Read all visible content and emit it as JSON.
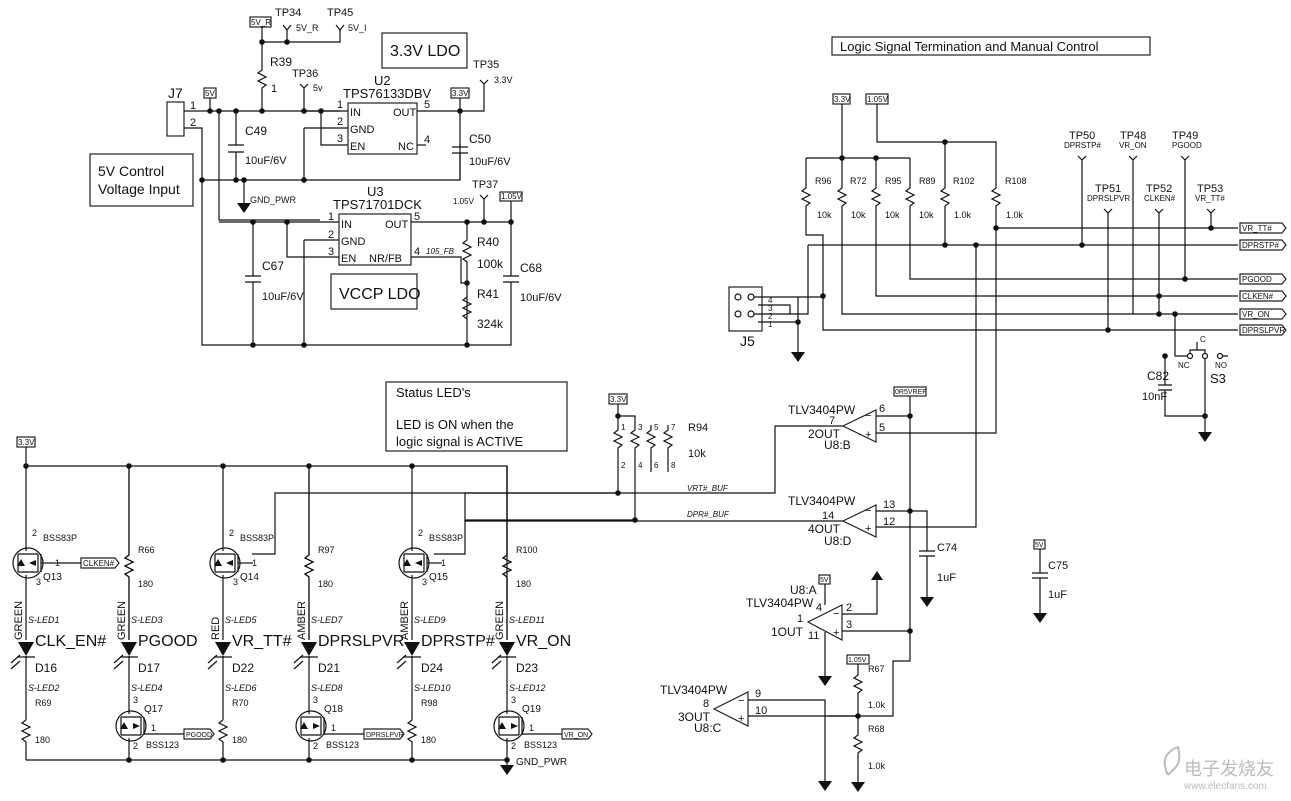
{
  "titles": {
    "ldo33": "3.3V LDO",
    "vccp": "VCCP LDO",
    "control_input_1": "5V Control",
    "control_input_2": "Voltage Input",
    "logic": "Logic Signal Termination and Manual Control",
    "status_1": "Status LED's",
    "status_2": "LED is ON when the",
    "status_3": "logic signal is ACTIVE"
  },
  "power_flags": {
    "v5r": "5V_R",
    "v5": "5V",
    "v33": "3.3V",
    "v105": "1.05V",
    "vref": "0R5VREF"
  },
  "testpoints": [
    {
      "ref": "TP34",
      "net": "5V_R"
    },
    {
      "ref": "TP45",
      "net": "5V_I"
    },
    {
      "ref": "TP36",
      "net": "5v"
    },
    {
      "ref": "TP35",
      "net": "3.3V"
    },
    {
      "ref": "TP37",
      "net": "1.05V"
    },
    {
      "ref": "TP50",
      "net": "DPRSTP#"
    },
    {
      "ref": "TP48",
      "net": "VR_ON"
    },
    {
      "ref": "TP49",
      "net": "PGOOD"
    },
    {
      "ref": "TP51",
      "net": "DPRSLPVR"
    },
    {
      "ref": "TP52",
      "net": "CLKEN#"
    },
    {
      "ref": "TP53",
      "net": "VR_TT#"
    }
  ],
  "connectors": {
    "j7": {
      "ref": "J7",
      "pins": [
        "1",
        "2"
      ]
    },
    "j5": {
      "ref": "J5",
      "pins": [
        "4",
        "3",
        "2",
        "1"
      ]
    }
  },
  "ics": {
    "u2": {
      "ref": "U2",
      "part": "TPS76133DBV",
      "pins": [
        {
          "num": "1",
          "name": "IN"
        },
        {
          "num": "2",
          "name": "GND"
        },
        {
          "num": "3",
          "name": "EN"
        },
        {
          "num": "5",
          "name": "OUT"
        },
        {
          "num": "4",
          "name": "NC"
        }
      ]
    },
    "u3": {
      "ref": "U3",
      "part": "TPS71701DCK",
      "pins": [
        {
          "num": "1",
          "name": "IN"
        },
        {
          "num": "2",
          "name": "GND"
        },
        {
          "num": "3",
          "name": "EN"
        },
        {
          "num": "5",
          "name": "OUT"
        },
        {
          "num": "4",
          "name": "NR/FB"
        }
      ]
    }
  },
  "nets": {
    "gnd_pwr": "GND_PWR",
    "fb": "105_FB",
    "vrt_buf": "VRT#_BUF",
    "dpr_buf": "DPR#_BUF"
  },
  "resistors": {
    "r39": {
      "ref": "R39",
      "value": "1"
    },
    "r40": {
      "ref": "R40",
      "value": "100k"
    },
    "r41": {
      "ref": "R41",
      "value": "324k"
    },
    "r96": {
      "ref": "R96",
      "value": "10k"
    },
    "r72": {
      "ref": "R72",
      "value": "10k"
    },
    "r95": {
      "ref": "R95",
      "value": "10k"
    },
    "r89": {
      "ref": "R89",
      "value": "10k"
    },
    "r102": {
      "ref": "R102",
      "value": "1.0k"
    },
    "r108": {
      "ref": "R108",
      "value": "1.0k"
    },
    "r94": {
      "ref": "R94",
      "value": "10k",
      "pins": [
        "1",
        "2",
        "3",
        "4",
        "5",
        "6",
        "7",
        "8"
      ]
    },
    "r66": {
      "ref": "R66",
      "value": "180"
    },
    "r97": {
      "ref": "R97",
      "value": "180"
    },
    "r100": {
      "ref": "R100",
      "value": "180"
    },
    "r69": {
      "ref": "R69",
      "value": "180"
    },
    "r70": {
      "ref": "R70",
      "value": "180"
    },
    "r98": {
      "ref": "R98",
      "value": "180"
    },
    "r67": {
      "ref": "R67",
      "value": "1.0k"
    },
    "r68": {
      "ref": "R68",
      "value": "1.0k"
    }
  },
  "capacitors": {
    "c49": {
      "ref": "C49",
      "value": "10uF/6V"
    },
    "c50": {
      "ref": "C50",
      "value": "10uF/6V"
    },
    "c67": {
      "ref": "C67",
      "value": "10uF/6V"
    },
    "c68": {
      "ref": "C68",
      "value": "10uF/6V"
    },
    "c82": {
      "ref": "C82",
      "value": "10nF"
    },
    "c74": {
      "ref": "C74",
      "value": "1uF"
    },
    "c75": {
      "ref": "C75",
      "value": "1uF"
    }
  },
  "switch": {
    "ref": "S3",
    "c": "C",
    "nc": "NC",
    "no": "NO"
  },
  "off_page": [
    "VR_TT#",
    "DPRSTP#",
    "PGOOD",
    "CLKEN#",
    "VR_ON",
    "DPRSLPVR"
  ],
  "comparators": [
    {
      "part": "TLV3404PW",
      "unit": "U8:B",
      "out": "2OUT",
      "pin_out": "7",
      "pin_neg": "6",
      "pin_pos": "5"
    },
    {
      "part": "TLV3404PW",
      "unit": "U8:D",
      "out": "4OUT",
      "pin_out": "14",
      "pin_neg": "13",
      "pin_pos": "12"
    },
    {
      "part": "TLV3404PW",
      "unit": "U8:A",
      "out": "1OUT",
      "pin_out": "1",
      "pin_neg": "2",
      "pin_pos": "3",
      "pin_vcc": "4",
      "pin_gnd": "11"
    },
    {
      "part": "TLV3404PW",
      "unit": "U8:C",
      "out": "3OUT",
      "pin_out": "8",
      "pin_neg": "9",
      "pin_pos": "10"
    }
  ],
  "leds": [
    {
      "ref": "D16",
      "color": "GREEN",
      "signal": "CLK_EN#",
      "pin_a": "S-LED1",
      "pin_k": "S-LED2"
    },
    {
      "ref": "D17",
      "color": "GREEN",
      "signal": "PGOOD",
      "pin_a": "S-LED3",
      "pin_k": "S-LED4"
    },
    {
      "ref": "D22",
      "color": "RED",
      "signal": "VR_TT#",
      "pin_a": "S-LED5",
      "pin_k": "S-LED6"
    },
    {
      "ref": "D21",
      "color": "AMBER",
      "signal": "DPRSLPVR",
      "pin_a": "S-LED7",
      "pin_k": "S-LED8"
    },
    {
      "ref": "D24",
      "color": "AMBER",
      "signal": "DPRSTP#",
      "pin_a": "S-LED9",
      "pin_k": "S-LED10"
    },
    {
      "ref": "D23",
      "color": "GREEN",
      "signal": "VR_ON",
      "pin_a": "S-LED11",
      "pin_k": "S-LED12"
    }
  ],
  "fets": {
    "q13": {
      "ref": "Q13",
      "part": "BSS83P",
      "net": "CLKEN#",
      "pins": [
        "2",
        "1",
        "3"
      ]
    },
    "q14": {
      "ref": "Q14",
      "part": "BSS83P",
      "pins": [
        "2",
        "1",
        "3"
      ]
    },
    "q15": {
      "ref": "Q15",
      "part": "BSS83P",
      "pins": [
        "2",
        "1",
        "3"
      ]
    },
    "q17": {
      "ref": "Q17",
      "part": "BSS123",
      "net": "PGOOD",
      "pins": [
        "3",
        "1",
        "2"
      ]
    },
    "q18": {
      "ref": "Q18",
      "part": "BSS123",
      "net": "DPRSLPVR",
      "pins": [
        "3",
        "1",
        "2"
      ]
    },
    "q19": {
      "ref": "Q19",
      "part": "BSS123",
      "net": "VR_ON",
      "pins": [
        "3",
        "1",
        "2"
      ]
    }
  },
  "watermark": {
    "line1": "电子发烧友",
    "line2": "www.elecfans.com"
  }
}
